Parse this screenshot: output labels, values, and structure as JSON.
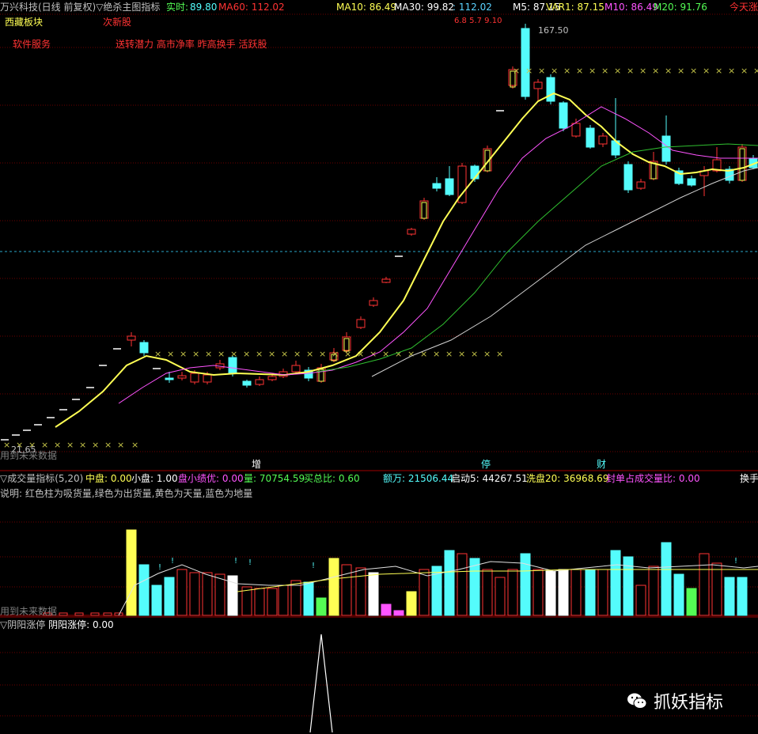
{
  "colors": {
    "red": "#ff3333",
    "cyan": "#54fcfc",
    "yellow": "#ffff54",
    "white": "#ffffff",
    "magenta": "#ff54ff",
    "green": "#54fc54",
    "grey": "#c0c0c0",
    "grid": "#8b0000",
    "blue": "#5ad2ff"
  },
  "header": {
    "stock": "万兴科技(日线 前复权)",
    "indicator": "▽绝杀主图指标",
    "realtime_label": "实时:",
    "realtime_value": "89.80",
    "ma60": "MA60: 112.02",
    "ma10": "MA10: 86.49",
    "ma30": "MA30: 99.82",
    "unnamed_value": ": 112.02",
    "m5": "M5: 87.15",
    "var1": "VAR1: 87.15",
    "m10": "M10: 86.49",
    "m20": "M20: 91.76",
    "today": "今天涨"
  },
  "tags": {
    "tibet": "西藏板块",
    "new_stock": "次新股",
    "software": "软件服务",
    "features": "送转潜力 高市净率 昨高换手 活跃股",
    "dates": "6.8 5.7 9.10"
  },
  "price": {
    "high_label": "167.50",
    "low_label": "21.65",
    "future_note": "用到未来数据",
    "marker_increase": "增",
    "marker_halt": "停",
    "marker_finance": "财"
  },
  "volume_panel": {
    "title": "▽成交量指标(5,20)",
    "mid_label": "中盘:",
    "mid_value": "0.00",
    "small_label": "小盘:",
    "small_value": "1.00",
    "you_label": "盘小绩优:",
    "you_value": "0.00",
    "vol_label": "量:",
    "vol_value": "70754.59",
    "buy_label": "买总比:",
    "buy_value": "0.60",
    "amount_label": "额万:",
    "amount_value": "21506.44",
    "start_label": "启动5:",
    "start_value": "44267.51",
    "wash_label": "洗盘20:",
    "wash_value": "36968.69",
    "seal_label": "封单占成交量比:",
    "seal_value": "0.00",
    "turnover": "换手",
    "desc": "说明: 红色柱为吸货量,绿色为出货量,黄色为天量,蓝色为地量",
    "future_note": "用到未来数据"
  },
  "yinyang_panel": {
    "title": "▽阴阳涨停",
    "label": "阴阳涨停:",
    "value": "0.00"
  },
  "watermark": "抓妖指标"
}
